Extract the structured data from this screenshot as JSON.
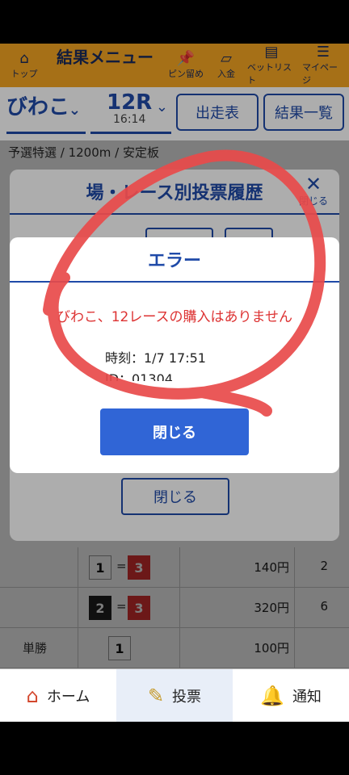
{
  "topnav": {
    "top": "トップ",
    "title": "結果メニュー",
    "pin": "ピン留め",
    "deposit": "入金",
    "betlist": "ベットリスト",
    "mypage": "マイページ"
  },
  "selector": {
    "venue": "びわこ",
    "race": "12R",
    "time": "16:14",
    "btn_entries": "出走表",
    "btn_results": "結果一覧"
  },
  "race_info": "予選特選 / 1200m / 安定板",
  "history_modal": {
    "title": "場・レース別投票履歴",
    "close_label": "閉じる",
    "close_button": "閉じる"
  },
  "error_modal": {
    "title": "エラー",
    "message": "びわこ、12レースの購入はありません",
    "time": "時刻：1/7 17:51",
    "id_partial": "ID：01304...",
    "close_button": "閉じる"
  },
  "table": {
    "rows": [
      {
        "bet_type": "",
        "a": "1",
        "b": "3",
        "amount": "140円",
        "count": "2"
      },
      {
        "bet_type": "",
        "a": "2",
        "b": "3",
        "amount": "320円",
        "count": "6"
      },
      {
        "bet_type": "単勝",
        "a": "1",
        "amount": "100円",
        "count": ""
      }
    ]
  },
  "bottom_nav": {
    "home": "ホーム",
    "vote": "投票",
    "notify": "通知"
  },
  "colors": {
    "accent": "#1f4aa8",
    "brand": "#f5a623",
    "error": "#d33333",
    "button": "#3065d6"
  }
}
